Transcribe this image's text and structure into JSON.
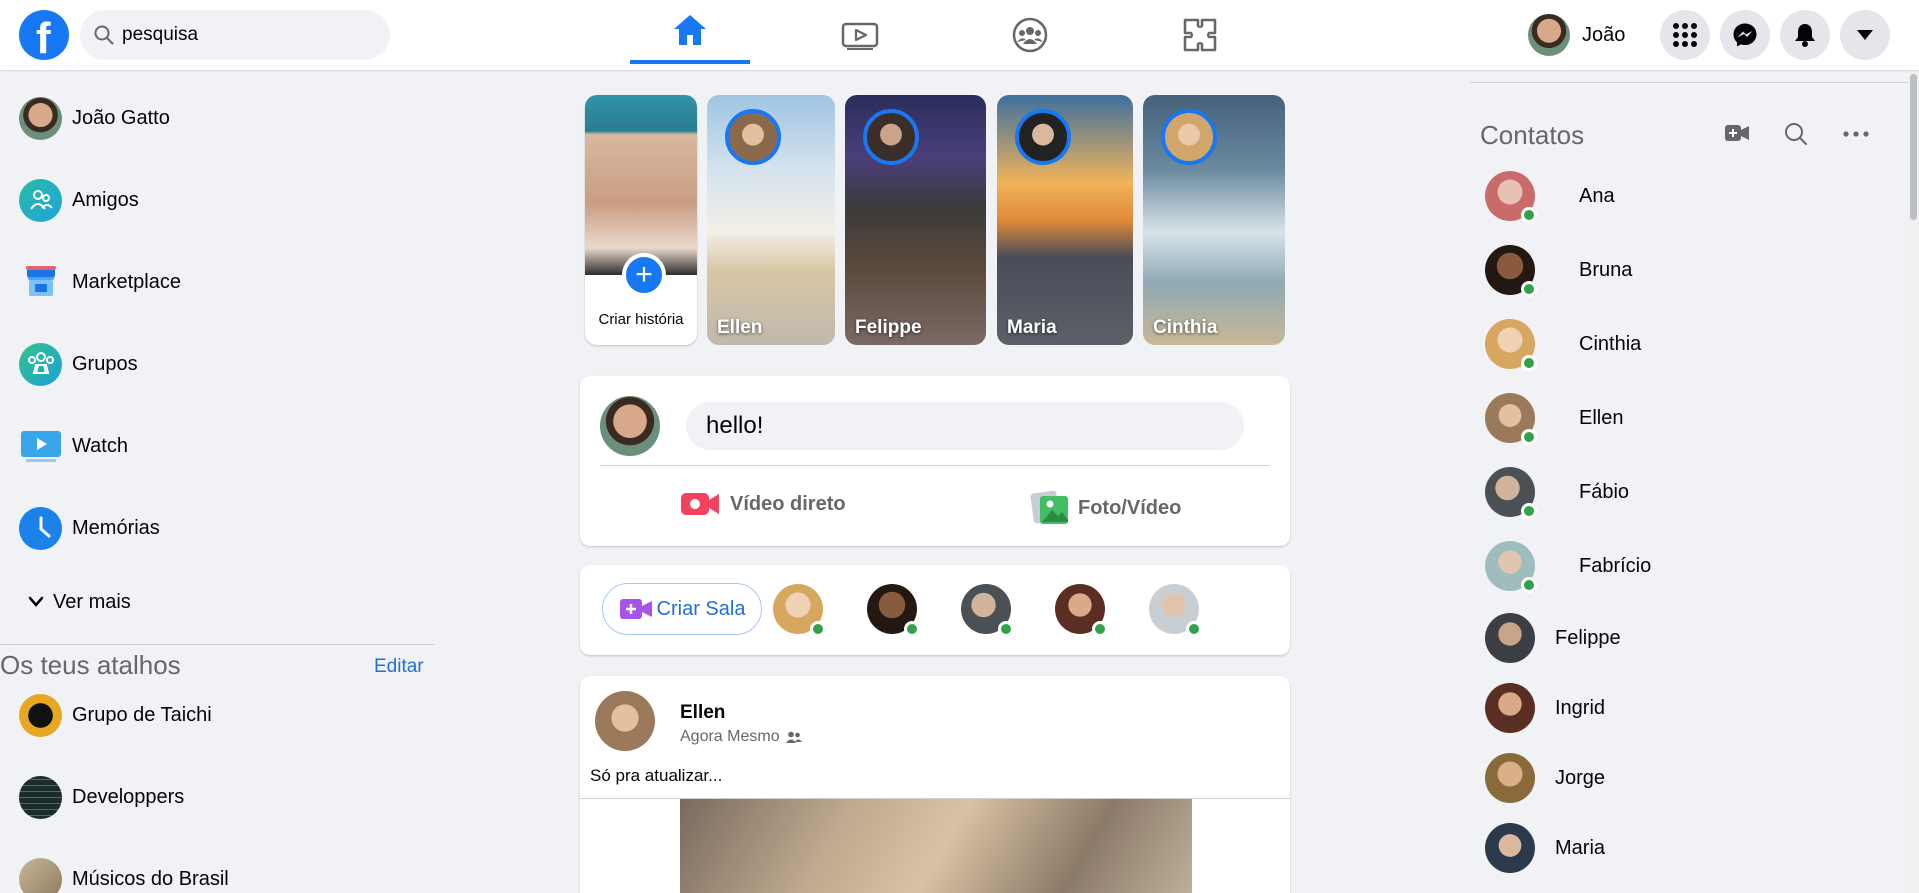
{
  "header": {
    "search": {
      "value": "pesquisa",
      "placeholder": ""
    },
    "tabs": [
      {
        "name": "home",
        "icon": "home-icon",
        "active": true
      },
      {
        "name": "watch",
        "icon": "watch-icon",
        "active": false
      },
      {
        "name": "groups",
        "icon": "groups-icon",
        "active": false
      },
      {
        "name": "gaming",
        "icon": "puzzle-icon",
        "active": false
      }
    ],
    "profile_name": "João",
    "buttons": [
      "menu-grid-icon",
      "messenger-icon",
      "bell-icon",
      "caret-down-icon"
    ],
    "accent_color": "#1877f2"
  },
  "sidebar": {
    "items": [
      {
        "label": "João Gatto",
        "icon": "avatar"
      },
      {
        "label": "Amigos",
        "icon": "friends-icon"
      },
      {
        "label": "Marketplace",
        "icon": "marketplace-icon"
      },
      {
        "label": "Grupos",
        "icon": "groups-icon"
      },
      {
        "label": "Watch",
        "icon": "watch-icon"
      },
      {
        "label": "Memórias",
        "icon": "clock-icon"
      }
    ],
    "see_more": "Ver mais",
    "shortcuts_title": "Os teus atalhos",
    "edit_label": "Editar",
    "shortcuts": [
      {
        "label": "Grupo de Taichi"
      },
      {
        "label": "Developpers"
      },
      {
        "label": "Músicos do Brasil"
      }
    ]
  },
  "stories": {
    "create_label": "Criar história",
    "items": [
      {
        "name": "Ellen"
      },
      {
        "name": "Felippe"
      },
      {
        "name": "Maria"
      },
      {
        "name": "Cinthia"
      }
    ]
  },
  "composer": {
    "input_value": "hello!",
    "live_video_label": "Vídeo direto",
    "photo_video_label": "Foto/Vídeo"
  },
  "rooms": {
    "create_label": "Criar Sala"
  },
  "post": {
    "author": "Ellen",
    "time": "Agora Mesmo",
    "text": "Só pra atualizar..."
  },
  "contacts": {
    "title": "Contatos",
    "items": [
      {
        "name": "Ana",
        "online": true
      },
      {
        "name": "Bruna",
        "online": true
      },
      {
        "name": "Cinthia",
        "online": true
      },
      {
        "name": "Ellen",
        "online": true
      },
      {
        "name": "Fábio",
        "online": true
      },
      {
        "name": "Fabrício",
        "online": true
      },
      {
        "name": "Felippe",
        "online": false
      },
      {
        "name": "Ingrid",
        "online": false
      },
      {
        "name": "Jorge",
        "online": false
      },
      {
        "name": "Maria",
        "online": false
      }
    ]
  }
}
